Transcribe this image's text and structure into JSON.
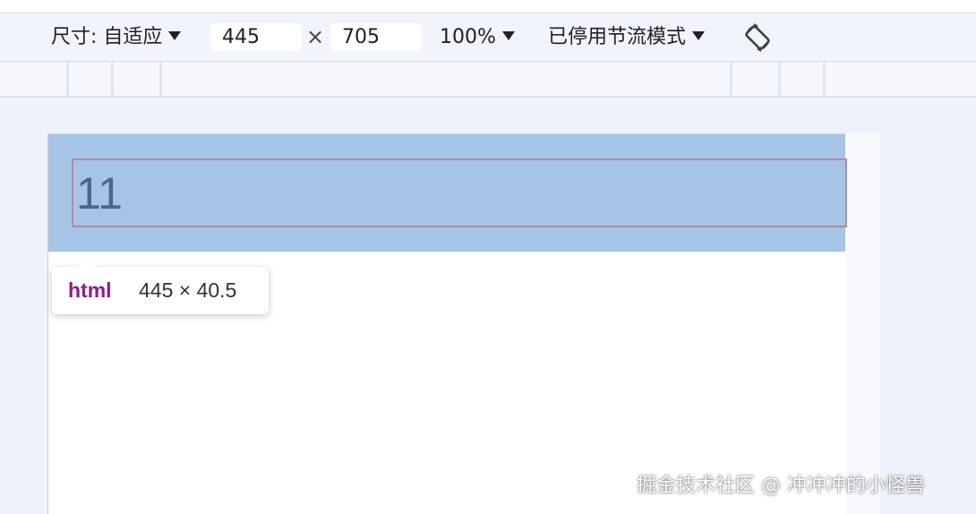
{
  "toolbar": {
    "dimensions_label": "尺寸: 自适应",
    "width_value": "445",
    "times_symbol": "×",
    "height_value": "705",
    "zoom_label": "100%",
    "throttling_label": "已停用节流模式",
    "rotate_icon": "rotate-icon"
  },
  "page": {
    "input_value": "11"
  },
  "inspect_tooltip": {
    "tag": "html",
    "size": "445 × 40.5"
  },
  "watermark": {
    "text": "掘金技术社区 @ 冲冲冲的小怪兽"
  },
  "colors": {
    "highlight": "#a6c4e5",
    "tag_purple": "#8b1d82",
    "outline": "#b18aa8"
  }
}
